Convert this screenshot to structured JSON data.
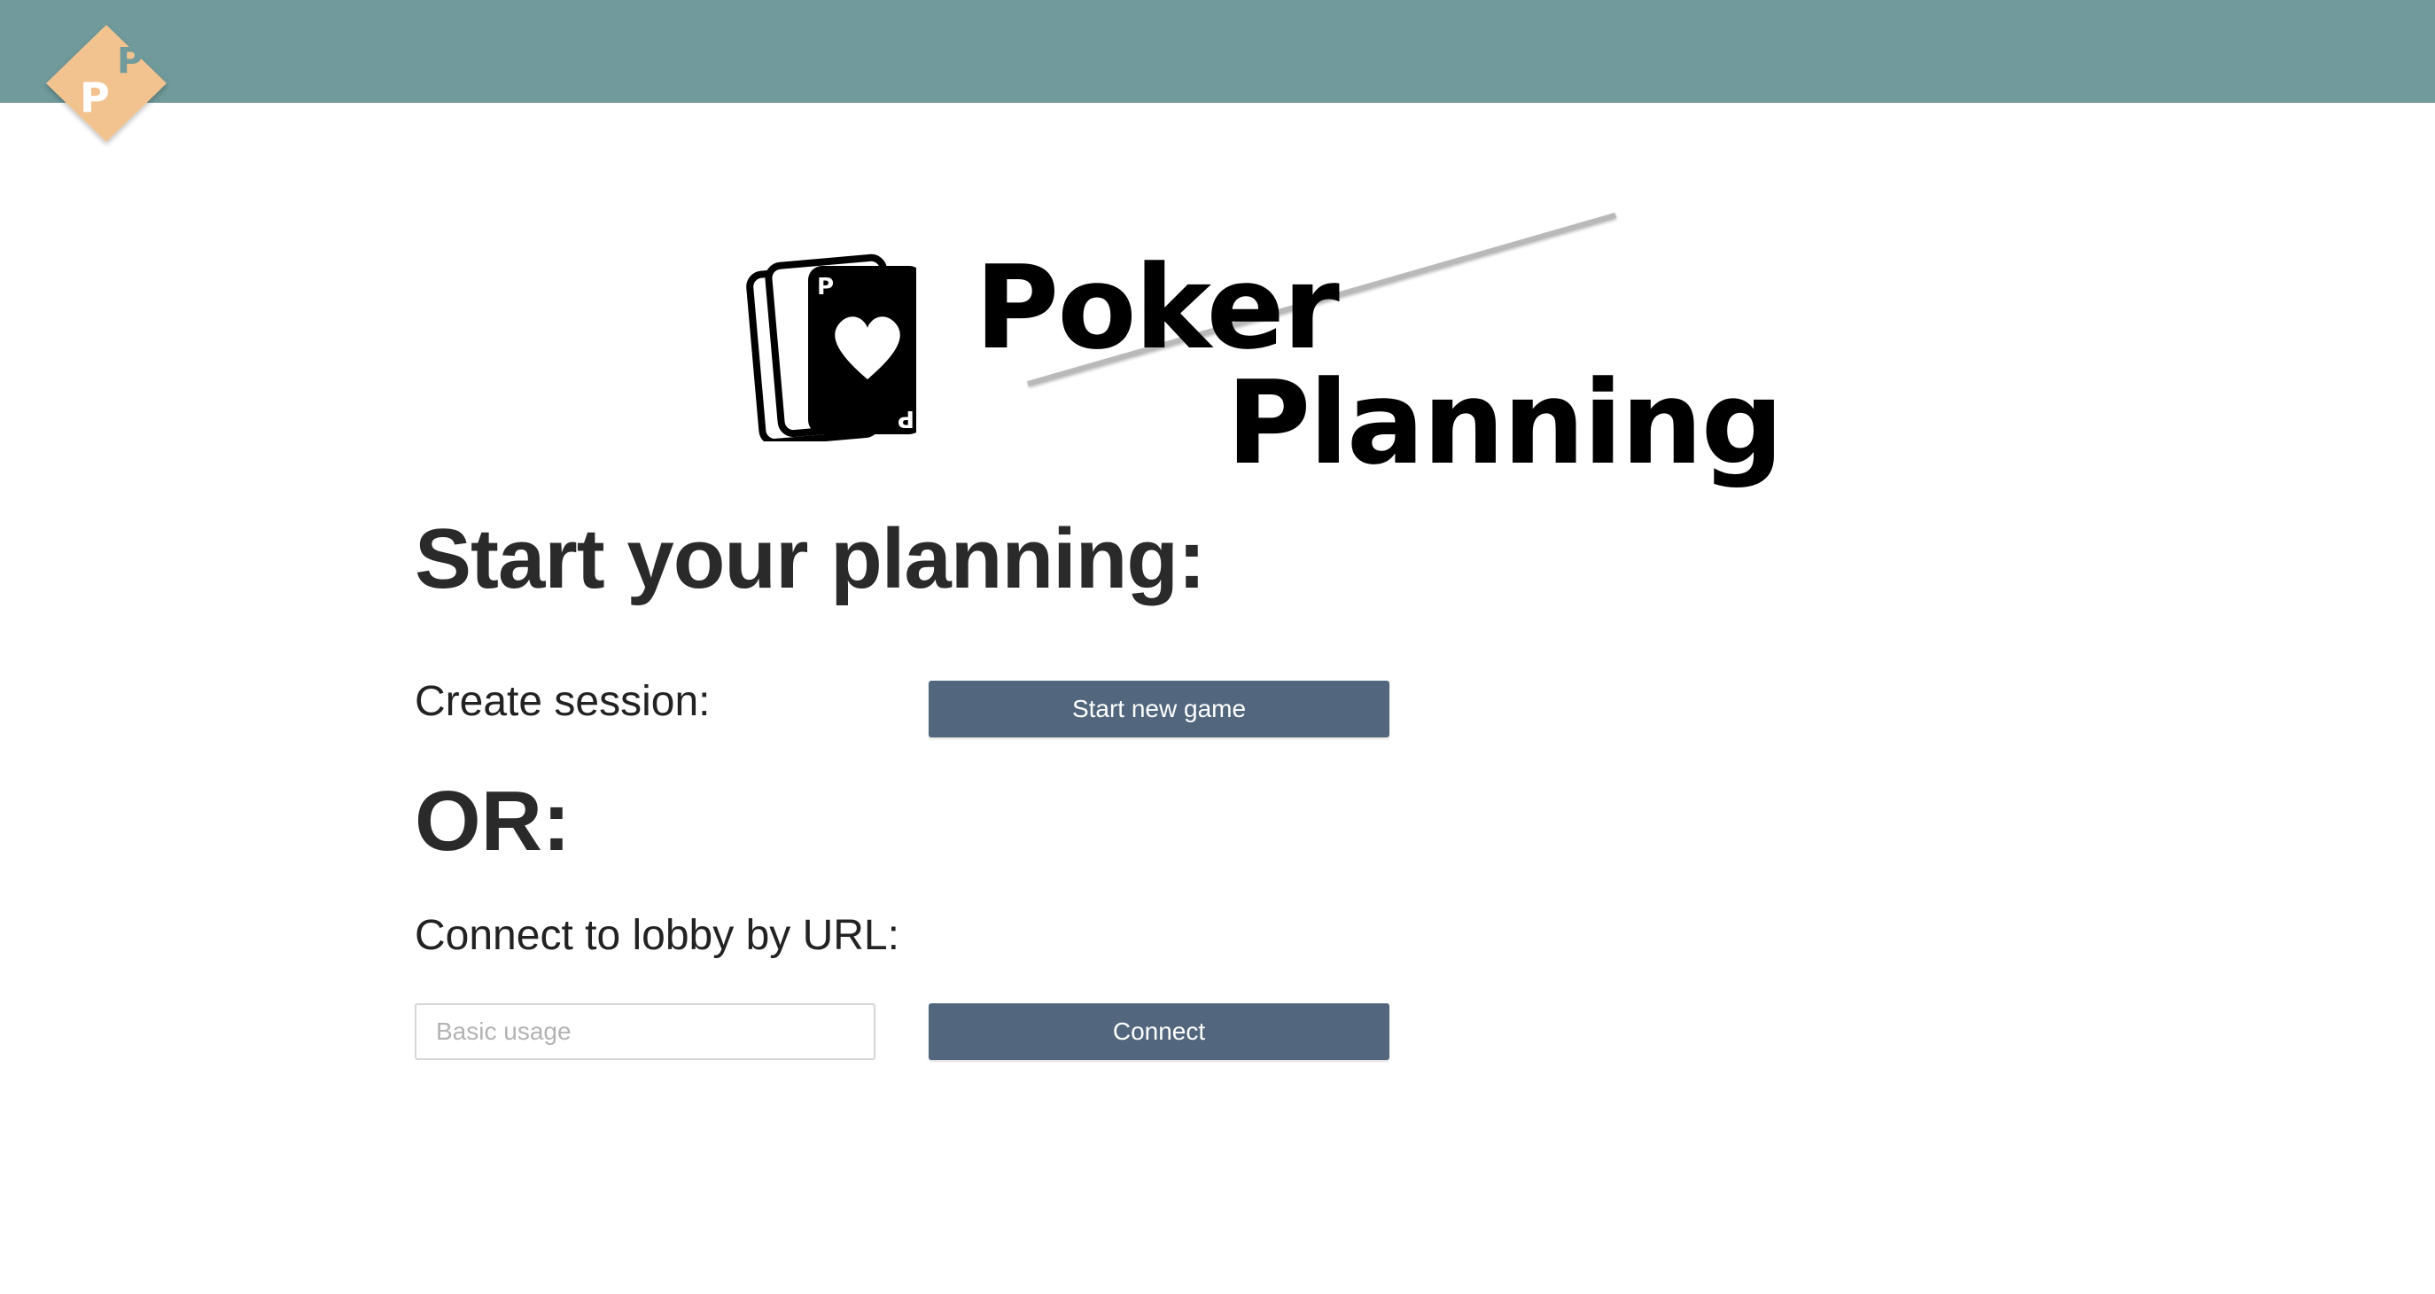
{
  "header": {
    "logo_letter_front": "P",
    "logo_letter_back": "P",
    "logo_icon": "diamond-p-logo-icon",
    "background_color": "#709a9b",
    "logo_color": "#f2c38f"
  },
  "hero": {
    "card_letter_top": "P",
    "card_letter_bottom": "P",
    "title_line1": "Poker",
    "title_line2": "Planning",
    "card_icon": "playing-cards-heart-icon"
  },
  "main": {
    "heading": "Start your planning:",
    "create_label": "Create session:",
    "start_button": "Start new game",
    "or_text": "OR:",
    "connect_label": "Connect to lobby by URL:",
    "url_placeholder": "Basic usage",
    "url_value": "",
    "connect_button": "Connect",
    "button_color": "#52677d"
  }
}
